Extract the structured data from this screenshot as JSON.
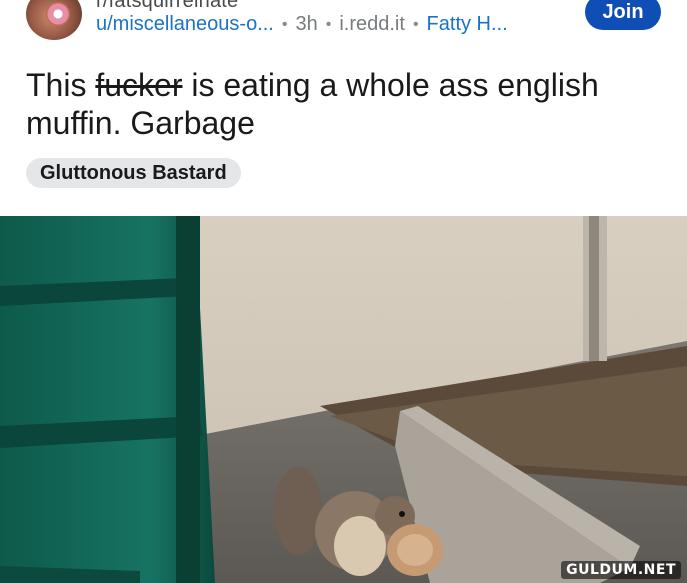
{
  "post": {
    "subreddit": "r/fatsquirrelhate",
    "user": "u/miscellaneous-o...",
    "age": "3h",
    "domain": "i.redd.it",
    "flair": "Fatty H...",
    "separator": "•",
    "join_label": "Join",
    "title_before": "This ",
    "title_strike": "fucker",
    "title_after": " is eating a whole ass english muffin. Garbage",
    "tag": "Gluttonous Bastard"
  },
  "image": {
    "watermark": "GULDUM.NET",
    "description_icon": "squirrel-photo"
  },
  "colors": {
    "link": "#1a73c9",
    "join_button": "#0f4fb5",
    "tag_bg": "#e4e6e8"
  }
}
